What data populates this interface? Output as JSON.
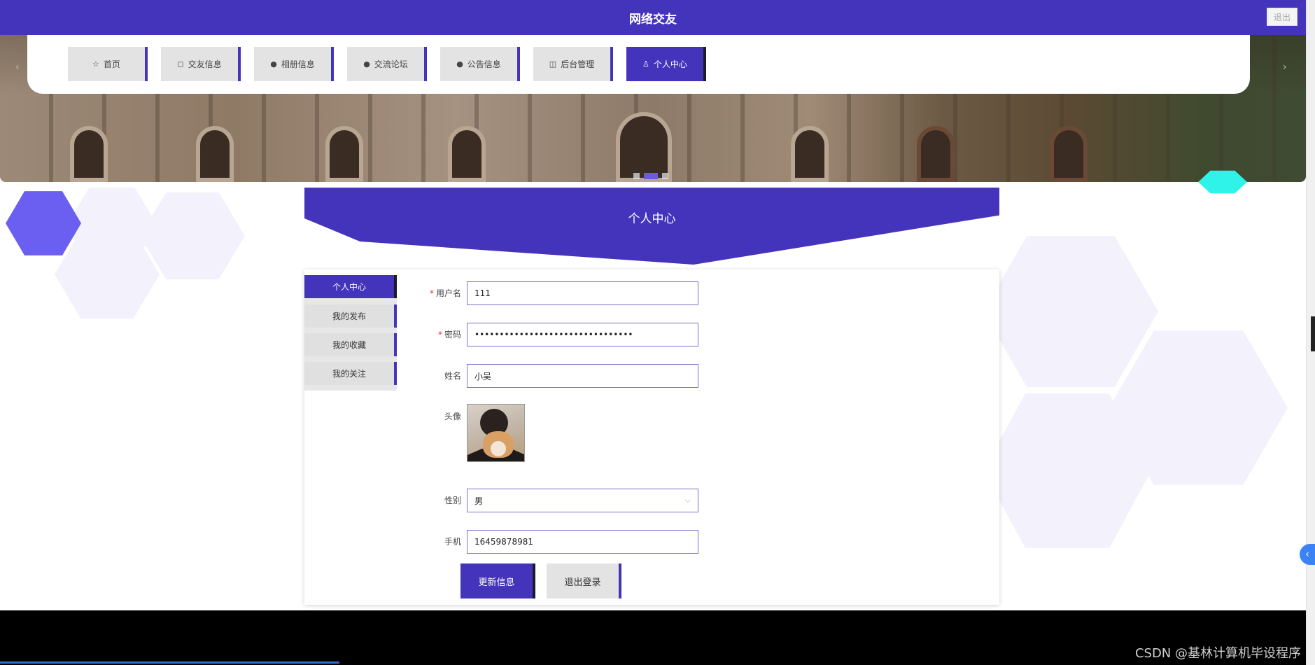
{
  "header": {
    "title": "网络交友",
    "logout_label": "退出"
  },
  "nav": {
    "items": [
      {
        "label": "首页",
        "icon": "star-icon",
        "glyph": "☆"
      },
      {
        "label": "交友信息",
        "icon": "bag-icon",
        "glyph": "◻"
      },
      {
        "label": "相册信息",
        "icon": "info-icon",
        "glyph": "●"
      },
      {
        "label": "交流论坛",
        "icon": "help-icon",
        "glyph": "●"
      },
      {
        "label": "公告信息",
        "icon": "info-icon",
        "glyph": "●"
      },
      {
        "label": "后台管理",
        "icon": "box-icon",
        "glyph": "◫"
      },
      {
        "label": "个人中心",
        "icon": "user-icon",
        "glyph": "♙",
        "active": true
      }
    ],
    "prev_arrow": "‹",
    "next_arrow": "›"
  },
  "carousel": {
    "slide_count": 3,
    "active_index": 1
  },
  "section": {
    "title": "个人中心"
  },
  "sidebar": {
    "items": [
      {
        "label": "个人中心",
        "active": true
      },
      {
        "label": "我的发布"
      },
      {
        "label": "我的收藏"
      },
      {
        "label": "我的关注"
      }
    ]
  },
  "form": {
    "username": {
      "label": "用户名",
      "required": "*",
      "value": "111"
    },
    "password": {
      "label": "密码",
      "required": "*",
      "value": "••••••••••••••••••••••••••••••••"
    },
    "name": {
      "label": "姓名",
      "value": "小吴"
    },
    "avatar": {
      "label": "头像"
    },
    "gender": {
      "label": "性别",
      "value": "男",
      "chevron": "⌵"
    },
    "phone": {
      "label": "手机",
      "value": "16459878981"
    },
    "update_button": "更新信息",
    "logout_button": "退出登录"
  },
  "watermark": "CSDN @基林计算机毕设程序",
  "side_tab_glyph": "‹",
  "colors": {
    "primary": "#4433bb",
    "hex_purple": "#6a5ff0",
    "hex_light": "#f2f1fc",
    "hex_cyan": "#2ff2e8"
  }
}
